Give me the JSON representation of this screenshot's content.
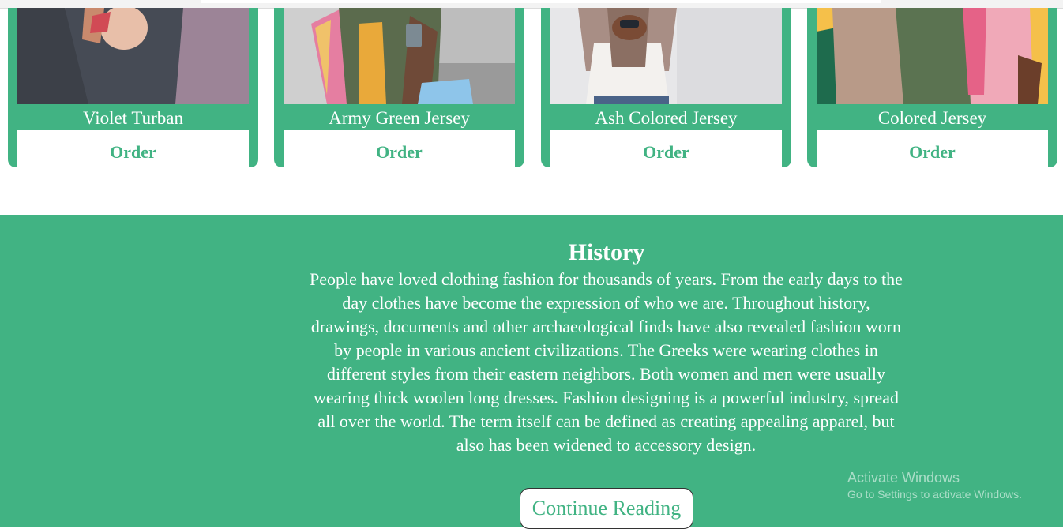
{
  "products": [
    {
      "name": "Violet Turban",
      "order_label": "Order"
    },
    {
      "name": "Army Green Jersey",
      "order_label": "Order"
    },
    {
      "name": "Ash Colored Jersey",
      "order_label": "Order"
    },
    {
      "name": "Colored Jersey",
      "order_label": "Order"
    }
  ],
  "history": {
    "title": "History",
    "body": "People have loved clothing fashion for thousands of years. From the early days to the day clothes have become the expression of who we are. Throughout history, drawings, documents and other archaeological finds have also revealed fashion worn by people in various ancient civilizations. The Greeks were wearing clothes in different styles from their eastern neighbors. Both women and men were usually wearing thick woolen long dresses. Fashion designing is a powerful industry, spread all over the world. The term itself can be defined as creating appealing apparel, but also has been widened to accessory design.",
    "button_label": "Continue Reading"
  },
  "watermark": {
    "title": "Activate Windows",
    "subtitle": "Go to Settings to activate Windows."
  },
  "colors": {
    "brand_green": "#41b383",
    "text_on_green": "#ffffff"
  }
}
